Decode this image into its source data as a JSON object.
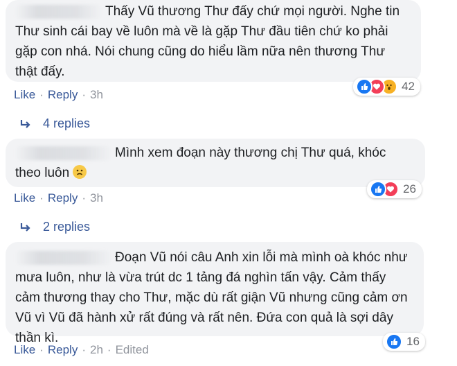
{
  "comments": [
    {
      "text": "Thấy Vũ thương Thư đấy chứ mọi người. Nghe tin Thư sinh cái bay về luôn mà về là gặp Thư đầu tiên chứ ko phải gặp con nhá. Nói chung cũng do hiểu lầm nữa nên thương Thư thật đấy.",
      "reaction_count": "42",
      "reactions": [
        "like-icon",
        "love-icon",
        "wow-icon"
      ],
      "like_label": "Like",
      "reply_label": "Reply",
      "time": "3h",
      "replies_label": "4 replies"
    },
    {
      "text": "Mình xem đoạn này thương chị Thư quá, khóc theo luôn",
      "reaction_count": "26",
      "reactions": [
        "like-icon",
        "love-icon"
      ],
      "like_label": "Like",
      "reply_label": "Reply",
      "time": "3h",
      "replies_label": "2 replies"
    },
    {
      "text": "Đoạn Vũ nói câu Anh xin lỗi mà mình oà khóc như mưa luôn, như là vừa trút dc 1 tảng đá nghìn tấn vậy. Cảm thấy cảm thương thay cho Thư, mặc dù rất giận Vũ nhưng cũng cảm ơn Vũ vì Vũ đã hành xử rất đúng và rất nên. Đứa con quả là sợi dây thần kì.",
      "reaction_count": "16",
      "reactions": [
        "like-icon"
      ],
      "like_label": "Like",
      "reply_label": "Reply",
      "time": "2h",
      "edited_label": "Edited"
    }
  ],
  "colors": {
    "bubble": "#f2f3f5",
    "link": "#385898",
    "muted": "#90949c",
    "like": "#1877f2",
    "love": "#f33e58",
    "wow": "#f7b125"
  }
}
